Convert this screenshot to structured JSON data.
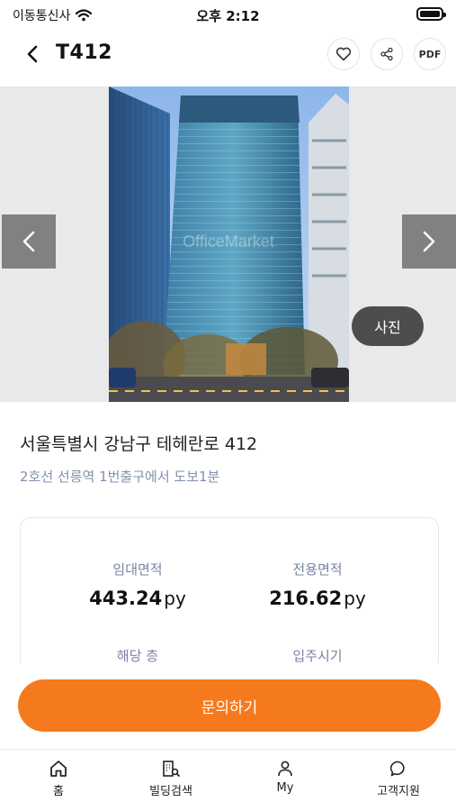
{
  "status_bar": {
    "carrier": "이동통신사",
    "time": "오후 2:12"
  },
  "header": {
    "title": "T412",
    "pdf_label": "PDF"
  },
  "gallery": {
    "watermark": "OfficeMarket",
    "photo_button": "사진"
  },
  "building": {
    "address": "서울특별시 강남구 테헤란로 412",
    "station": "2호선 선릉역 1번출구에서 도보1분"
  },
  "stats": [
    {
      "label": "임대면적",
      "value": "443.24",
      "unit": "py"
    },
    {
      "label": "전용면적",
      "value": "216.62",
      "unit": "py"
    },
    {
      "label": "해당 층",
      "value": "",
      "unit": ""
    },
    {
      "label": "입주시기",
      "value": "",
      "unit": ""
    }
  ],
  "cta": {
    "label": "문의하기"
  },
  "tabbar": {
    "items": [
      {
        "label": "홈",
        "icon": "home-icon"
      },
      {
        "label": "빌딩검색",
        "icon": "building-search-icon"
      },
      {
        "label": "My",
        "icon": "person-icon"
      },
      {
        "label": "고객지원",
        "icon": "chat-icon"
      }
    ]
  },
  "colors": {
    "accent": "#f57a1d",
    "secondary_text": "#8391ae"
  }
}
